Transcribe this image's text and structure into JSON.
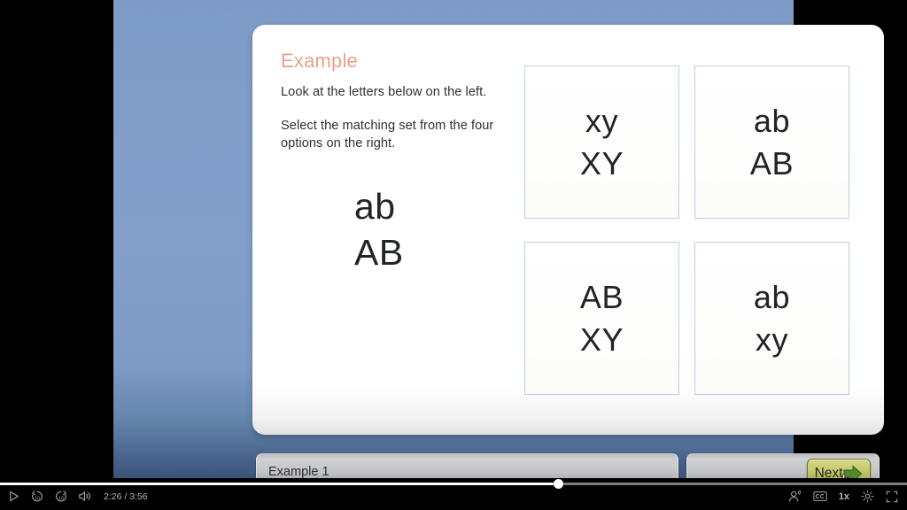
{
  "slide": {
    "heading": "Example",
    "instruction_1": "Look at the letters below on the left.",
    "instruction_2": "Select the matching set from the four options on the right.",
    "prompt": {
      "line1": "ab",
      "line2": "AB"
    },
    "options": [
      {
        "line1": "xy",
        "line2": "XY"
      },
      {
        "line1": "ab",
        "line2": "AB"
      },
      {
        "line1": "AB",
        "line2": "XY"
      },
      {
        "line1": "ab",
        "line2": "xy"
      }
    ],
    "accent_color": "#e8a289",
    "background_color": "#839fca",
    "option_border_color": "#bdd0e3"
  },
  "controls": {
    "title_label": "Example 1",
    "next_label": "Next",
    "next_arrow_icon": "arrow-right-icon",
    "cursor_icon": "hand-cursor-icon",
    "next_button_color": "#b5ba5e"
  },
  "player": {
    "play_icon": "play-icon",
    "rewind_icon": "rewind-10-icon",
    "forward_icon": "forward-10-icon",
    "volume_icon": "volume-icon",
    "timecode": "2:26 / 3:56",
    "elapsed": "2:26",
    "duration": "3:56",
    "progress_percent": 61.6,
    "account_icon": "account-icon",
    "captions_icon": "closed-captions-icon",
    "speed_label": "1x",
    "settings_icon": "gear-icon",
    "fullscreen_icon": "fullscreen-icon"
  }
}
